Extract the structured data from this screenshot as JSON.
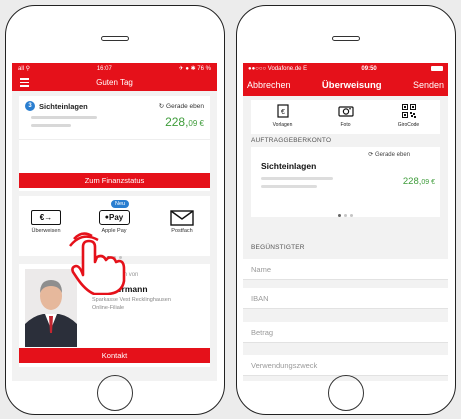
{
  "left": {
    "status": {
      "carrier": "all ⚲",
      "time": "16:07",
      "battery": "✈ ● ✱ 76 %"
    },
    "header": {
      "title": "Guten Tag"
    },
    "account": {
      "badge": "3",
      "name": "Sichteinlagen",
      "refresh": "Gerade eben",
      "balance_main": "228,",
      "balance_cents": "09 €"
    },
    "finanzstatus_button": "Zum Finanzstatus",
    "quick_actions": [
      {
        "label": "Überweisen",
        "icon": "transfer-icon"
      },
      {
        "label": "Apple Pay",
        "icon": "apple-pay-icon",
        "badge": "Neu"
      },
      {
        "label": "Postfach",
        "icon": "mail-icon"
      }
    ],
    "advisor": {
      "label": "den beraten von",
      "name": "Mustermann",
      "branch": "Sparkasse Vest Recklinghausen",
      "unit": "Online-Filiale"
    },
    "kontakt_button": "Kontakt",
    "euro_glyph": "€",
    "pay_text": "Pay"
  },
  "right": {
    "status": {
      "carrier": "●●○○○ Vodafone.de",
      "network": "E",
      "time": "09:50"
    },
    "header": {
      "cancel": "Abbrechen",
      "title": "Überweisung",
      "send": "Senden"
    },
    "actions": [
      {
        "label": "Vorlagen",
        "icon": "template-icon"
      },
      {
        "label": "Foto",
        "icon": "camera-icon"
      },
      {
        "label": "GiroCode",
        "icon": "qr-code-icon"
      }
    ],
    "section_orderer": "AUFTRAGGEBERKONTO",
    "account": {
      "refresh": "Gerade eben",
      "name": "Sichteinlagen",
      "balance_main": "228,",
      "balance_cents": "09 €"
    },
    "section_recipient": "BEGÜNSTIGTER",
    "fields": {
      "name": "Name",
      "iban": "IBAN",
      "amount": "Betrag",
      "purpose": "Verwendungszweck"
    }
  },
  "colors": {
    "brand_red": "#e5111a",
    "balance_green": "#3e9c3a",
    "badge_blue": "#2a7ed0"
  }
}
